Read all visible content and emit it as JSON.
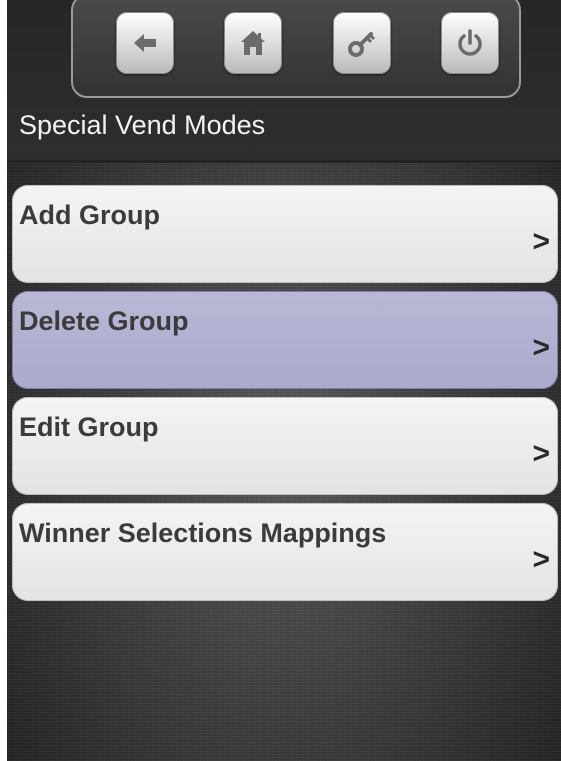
{
  "header": {
    "title": "Special Vend Modes",
    "toolbar": [
      {
        "icon": "back-arrow-icon",
        "name": "back-button"
      },
      {
        "icon": "home-icon",
        "name": "home-button"
      },
      {
        "icon": "key-icon",
        "name": "key-button"
      },
      {
        "icon": "power-icon",
        "name": "power-button"
      }
    ]
  },
  "menu": {
    "items": [
      {
        "label": "Add Group",
        "chevron": ">",
        "selected": false
      },
      {
        "label": "Delete Group",
        "chevron": ">",
        "selected": true
      },
      {
        "label": "Edit Group",
        "chevron": ">",
        "selected": false
      },
      {
        "label": "Winner Selections Mappings",
        "chevron": ">",
        "selected": false
      }
    ]
  },
  "colors": {
    "item_background": "#e8e8e8",
    "item_selected_background": "#afb0d0",
    "icon_color": "#6b6b6b"
  }
}
